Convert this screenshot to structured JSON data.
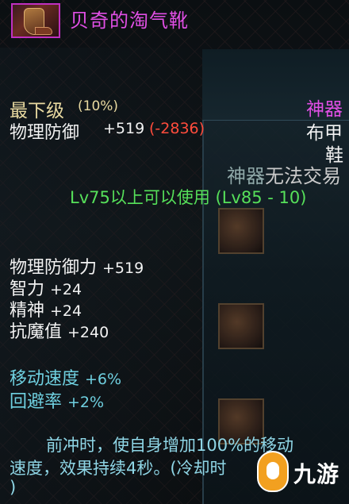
{
  "item": {
    "name": "贝奇的淘气靴",
    "icon": "boot-icon",
    "rarity_color": "#e14fe5"
  },
  "grade": {
    "label": "最下级",
    "percent": "(10%)"
  },
  "defense": {
    "label": "物理防御",
    "value": "+519",
    "diff": "(-2836)"
  },
  "type": {
    "rarity": "神器",
    "category1": "布甲",
    "category2": "鞋"
  },
  "trade": {
    "prefix": "神器",
    "text": "无法交易"
  },
  "level_req": "Lv75以上可以使用 (Lv85 - 10)",
  "stats": [
    {
      "label": "物理防御力",
      "value": "+519"
    },
    {
      "label": "智力",
      "value": "+24"
    },
    {
      "label": "精神",
      "value": "+24"
    },
    {
      "label": "抗魔值",
      "value": "+240"
    }
  ],
  "speed_stats": [
    {
      "label": "移动速度",
      "value": "+6%"
    },
    {
      "label": "回避率",
      "value": "+2%"
    }
  ],
  "description": [
    "前冲时，使自身增加100%的移动",
    "速度，效果持续4秒。(冷却时",
    ")"
  ],
  "watermark": {
    "brand": "九游",
    "icon": "watermark-badge-icon"
  }
}
